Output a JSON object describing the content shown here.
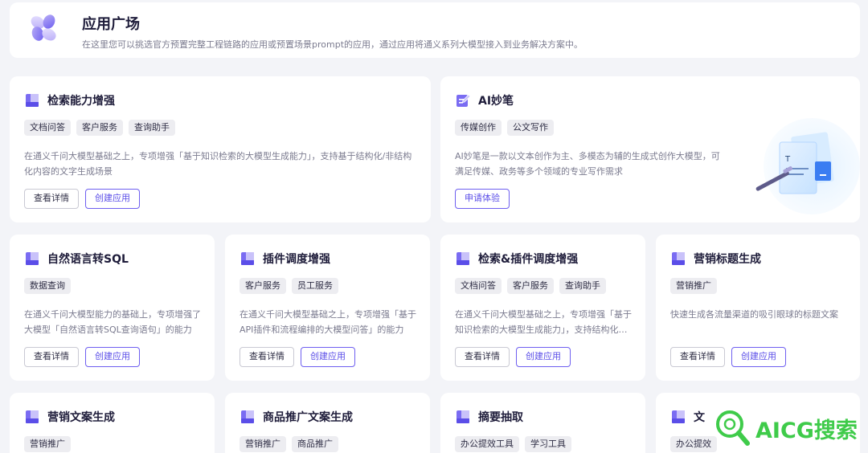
{
  "header": {
    "title": "应用广场",
    "description": "在这里您可以挑选官方预置完整工程链路的应用或预置场景prompt的应用，通过应用将通义系列大模型接入到业务解决方案中。"
  },
  "colors": {
    "accent": "#6e5ff0",
    "tag_bg": "#ededf1",
    "page_bg": "#f3f4f8",
    "watermark": "#3fcb4a"
  },
  "buttons": {
    "details": "查看详情",
    "create": "创建应用",
    "apply": "申请体验"
  },
  "cards": [
    {
      "title": "检索能力增强",
      "icon": "app-bookmark-icon",
      "tags": [
        "文档问答",
        "客户服务",
        "查询助手"
      ],
      "description": "在通义千问大模型基础之上，专项增强「基于知识检索的大模型生成能力」，支持基于结构化/非结构化内容的文字生成场景"
    },
    {
      "title": "AI妙笔",
      "icon": "pen-edit-icon",
      "tags": [
        "传媒创作",
        "公文写作"
      ],
      "description": "AI妙笔是一款以文本创作为主、多模态为辅的生成式创作大模型，可满足传媒、政务等多个领域的专业写作需求"
    },
    {
      "title": "自然语言转SQL",
      "icon": "app-bookmark-icon",
      "tags": [
        "数据查询"
      ],
      "description": "在通义千问大模型能力的基础上，专项增强了大模型「自然语言转SQL查询语句」的能力"
    },
    {
      "title": "插件调度增强",
      "icon": "app-bookmark-icon",
      "tags": [
        "客户服务",
        "员工服务"
      ],
      "description": "在通义千问大模型基础之上，专项增强「基于API插件和流程编排的大模型问答」的能力"
    },
    {
      "title": "检索&插件调度增强",
      "icon": "app-bookmark-icon",
      "tags": [
        "文档问答",
        "客户服务",
        "查询助手"
      ],
      "description": "在通义千问大模型基础之上，专项增强「基于知识检索的大模型生成能力」，支持结构化与插件调度"
    },
    {
      "title": "营销标题生成",
      "icon": "app-bookmark-icon",
      "tags": [
        "营销推广"
      ],
      "description": "快速生成各流量渠道的吸引眼球的标题文案"
    },
    {
      "title": "营销文案生成",
      "icon": "app-bookmark-icon",
      "tags": [
        "营销推广"
      ],
      "description": ""
    },
    {
      "title": "商品推广文案生成",
      "icon": "app-bookmark-icon",
      "tags": [
        "营销推广",
        "商品推广"
      ],
      "description": ""
    },
    {
      "title": "摘要抽取",
      "icon": "app-bookmark-icon",
      "tags": [
        "办公提效工具",
        "学习工具"
      ],
      "description": ""
    },
    {
      "title": "文",
      "icon": "app-bookmark-icon",
      "tags": [
        "办公提效"
      ],
      "description": ""
    }
  ],
  "watermark": {
    "text": "AICG搜索",
    "icon": "magnifier-icon"
  }
}
